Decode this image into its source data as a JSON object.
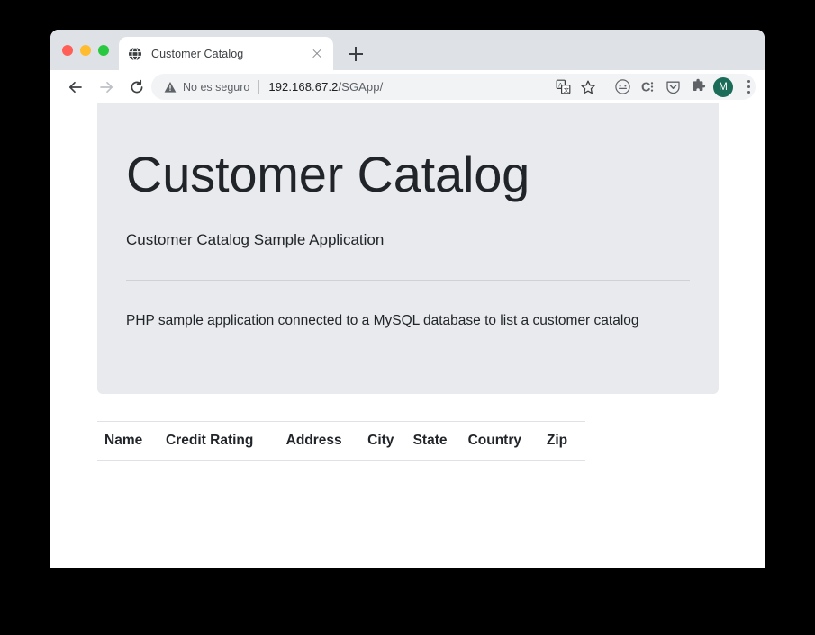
{
  "window": {
    "traffic_lights": [
      "close",
      "minimize",
      "maximize"
    ]
  },
  "tabstrip": {
    "tab": {
      "title": "Customer Catalog",
      "favicon": "globe-icon",
      "close": "close-icon"
    },
    "new_tab": "+"
  },
  "toolbar": {
    "back": "back-arrow-icon",
    "forward": "forward-arrow-icon",
    "reload": "reload-icon",
    "security_label": "No es seguro",
    "security_icon": "warning-triangle-icon",
    "url_host": "192.168.67.2",
    "url_path": "/SGApp/",
    "icons": [
      "translate-icon",
      "bookmark-star-icon",
      "incognito-dots-icon",
      "extension-c-icon",
      "pocket-shield-icon",
      "puzzle-extensions-icon"
    ],
    "avatar_initial": "M",
    "menu": "kebab-menu-icon"
  },
  "page": {
    "jumbotron": {
      "title": "Customer Catalog",
      "subtitle": "Customer Catalog Sample Application",
      "description": "PHP sample application connected to a MySQL database to list a customer catalog"
    },
    "table": {
      "columns": [
        "Name",
        "Credit Rating",
        "Address",
        "City",
        "State",
        "Country",
        "Zip"
      ],
      "rows": []
    }
  },
  "colors": {
    "tabstrip_bg": "#dee1e6",
    "jumbotron_bg": "#e8eaed",
    "avatar_bg": "#1a6b57",
    "text": "#212529",
    "muted": "#5f6368",
    "desktop_bg": "#000000"
  }
}
